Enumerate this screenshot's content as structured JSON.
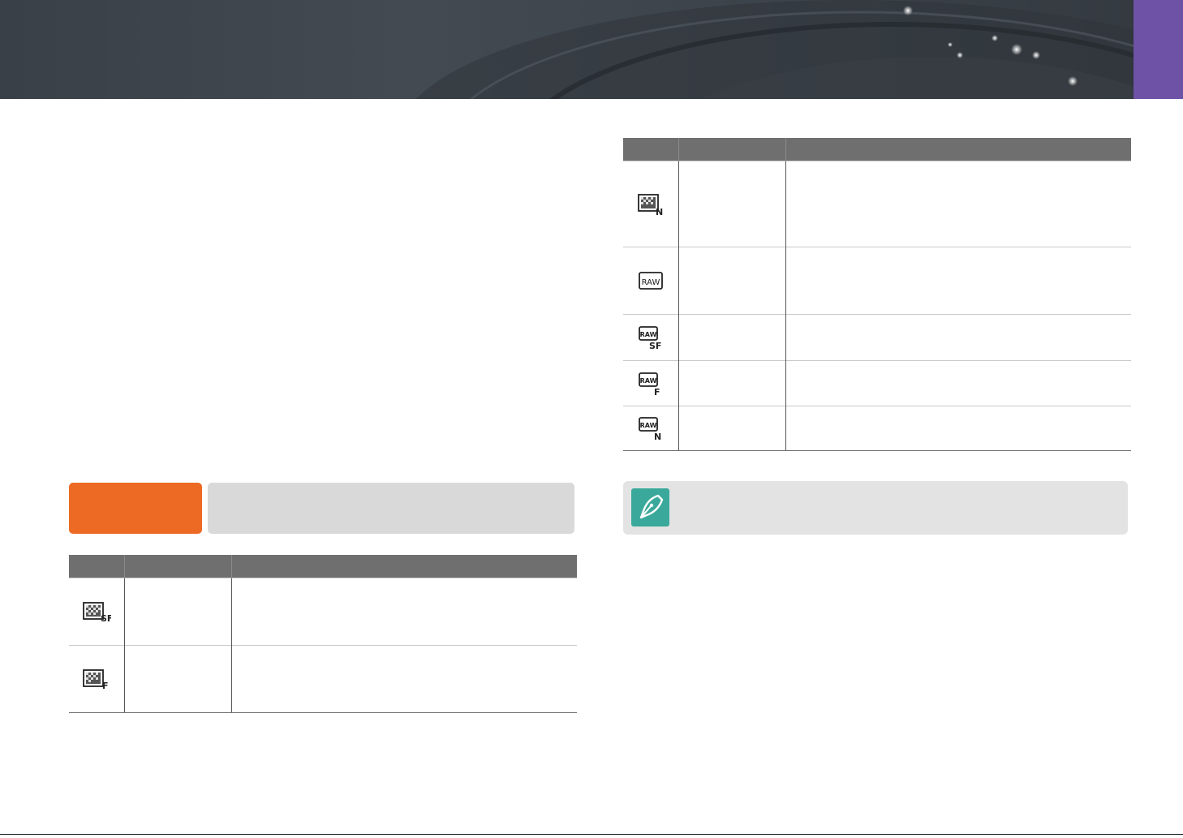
{
  "header": {
    "chapter_tab_color": "#6e52a6"
  },
  "option_bar": {
    "badge_color": "#ec6a24"
  },
  "table_left": {
    "rows": [
      {
        "icon": "jpeg-super-fine-icon"
      },
      {
        "icon": "jpeg-fine-icon"
      }
    ]
  },
  "table_right": {
    "rows": [
      {
        "icon": "jpeg-normal-icon"
      },
      {
        "icon": "raw-icon"
      },
      {
        "icon": "raw-plus-jpeg-super-fine-icon"
      },
      {
        "icon": "raw-plus-jpeg-fine-icon"
      },
      {
        "icon": "raw-plus-jpeg-normal-icon"
      }
    ]
  },
  "note": {
    "icon": "pen-nib-icon",
    "color": "#3aa99b"
  }
}
